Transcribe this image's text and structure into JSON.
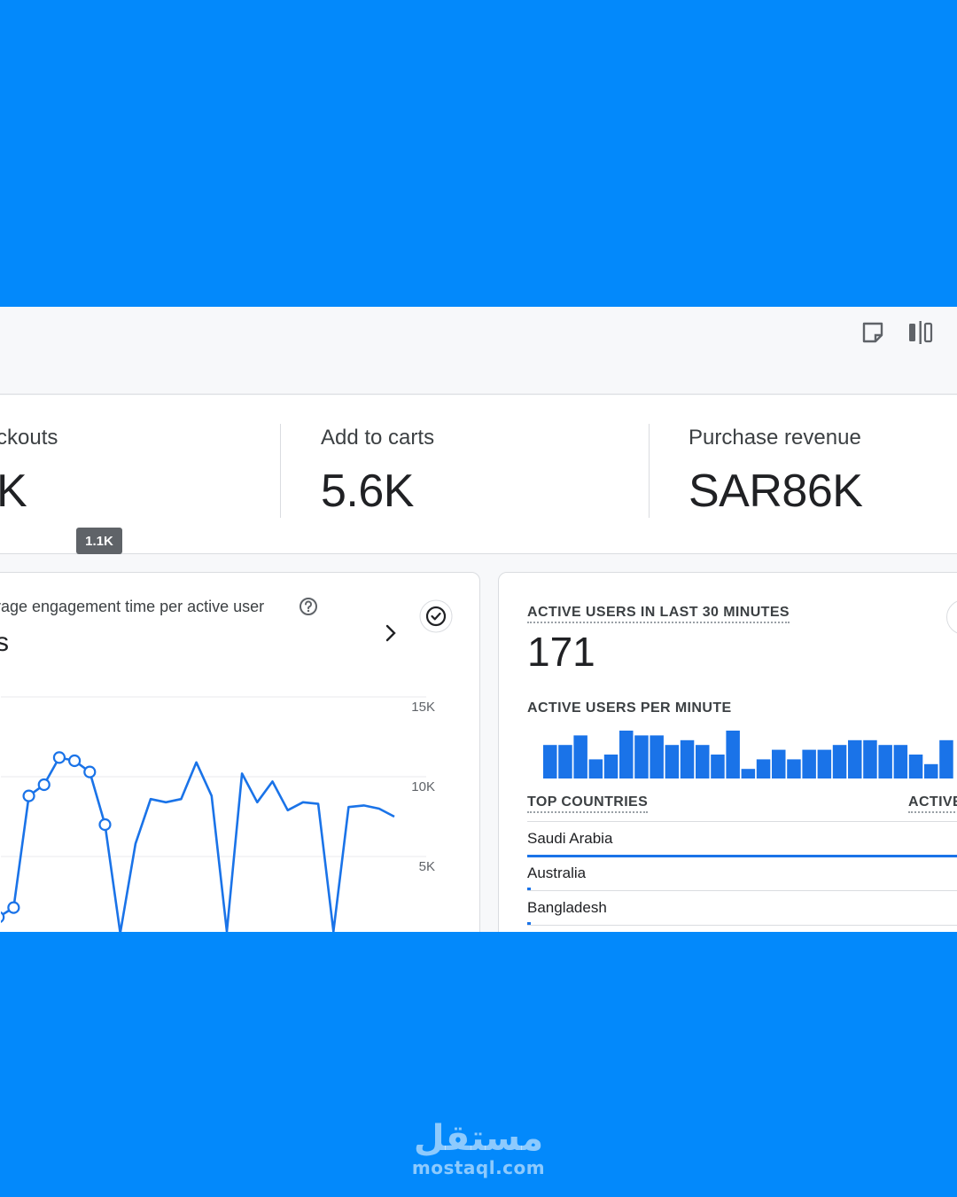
{
  "toolbar": {
    "icons": [
      "note-icon",
      "compare-icon"
    ]
  },
  "kpis": [
    {
      "label": "ckouts",
      "value": "K"
    },
    {
      "label": "Add to carts",
      "value": "5.6K"
    },
    {
      "label": "Purchase revenue",
      "value": "SAR86K"
    }
  ],
  "tooltip": "1.1K",
  "engagement_card": {
    "title": "rage engagement time per active user",
    "value": "s"
  },
  "chart_data": {
    "type": "line",
    "ylim": [
      0,
      15000
    ],
    "y_ticks": [
      "15K",
      "10K",
      "5K"
    ],
    "series": [
      {
        "values": [
          0,
          1200,
          1800,
          8800,
          9500,
          11200,
          11000,
          10300,
          7000,
          200,
          5800,
          8600,
          8400,
          8600,
          10900,
          8800,
          300,
          10200,
          8400,
          9700,
          7900,
          8400,
          8300,
          300,
          8100,
          8200,
          8000,
          7500
        ],
        "marked_points": [
          1,
          2,
          3,
          4,
          5,
          6,
          7,
          8
        ]
      }
    ]
  },
  "realtime_card": {
    "title": "ACTIVE USERS IN LAST 30 MINUTES",
    "value": "171",
    "per_minute_label": "ACTIVE USERS PER MINUTE",
    "per_minute_values": [
      7,
      7,
      9,
      4,
      5,
      10,
      9,
      9,
      7,
      8,
      7,
      5,
      10,
      2,
      4,
      6,
      4,
      6,
      6,
      7,
      8,
      8,
      7,
      7,
      5,
      3,
      8
    ],
    "top_countries_label": "TOP COUNTRIES",
    "active_users_label": "ACTIVE",
    "countries": [
      {
        "name": "Saudi Arabia",
        "share": 1.0
      },
      {
        "name": "Australia",
        "share": 0.008
      },
      {
        "name": "Bangladesh",
        "share": 0.008
      }
    ]
  },
  "watermark": {
    "arabic": "مستقل",
    "latin": "mostaql.com"
  }
}
